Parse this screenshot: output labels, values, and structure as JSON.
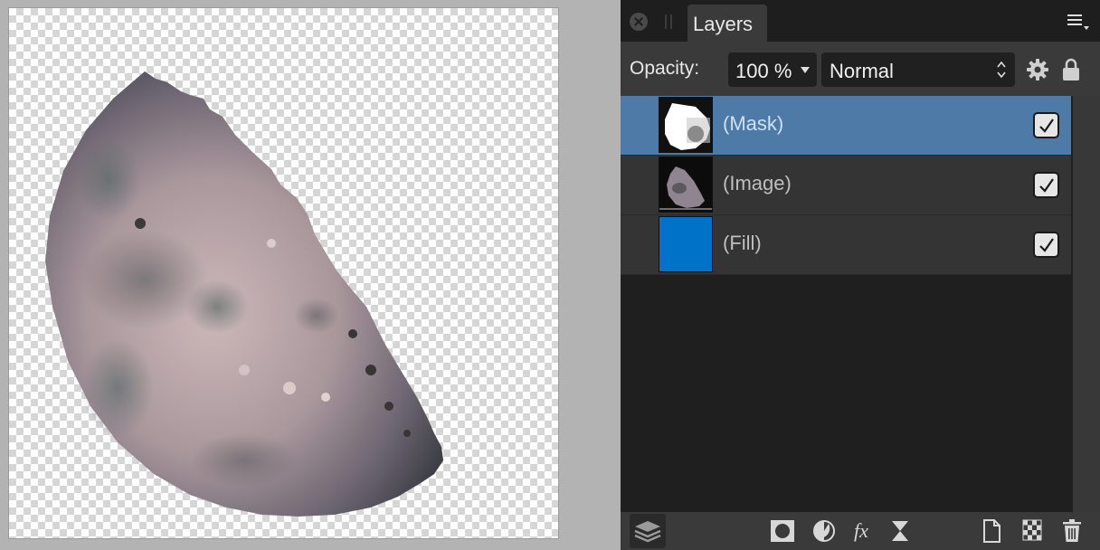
{
  "panel": {
    "tab_label": "Layers",
    "icons": {
      "close": "close-icon",
      "grip": "grip-icon",
      "menu": "panel-menu-icon"
    }
  },
  "opacity": {
    "label": "Opacity:",
    "value": "100 %",
    "blend_mode": "Normal",
    "settings_icon": "gear-icon",
    "lock_icon": "lock-icon"
  },
  "layers": [
    {
      "name": "(Mask)",
      "visible": true,
      "selected": true,
      "thumb": "mask-thumbnail"
    },
    {
      "name": "(Image)",
      "visible": true,
      "selected": false,
      "thumb": "moon-thumbnail"
    },
    {
      "name": "(Fill)",
      "visible": true,
      "selected": false,
      "thumb": "fill-thumbnail"
    }
  ],
  "colors": {
    "fill_layer": "#0072c8",
    "selection": "#4e7aa8",
    "panel_bg": "#2a2a2a"
  },
  "bottom_toolbar": [
    "layers-stack-icon",
    "mask-layer-icon",
    "adjustment-icon",
    "fx-icon",
    "live-filter-icon",
    "new-pixel-layer-icon",
    "transparency-icon",
    "trash-icon"
  ]
}
